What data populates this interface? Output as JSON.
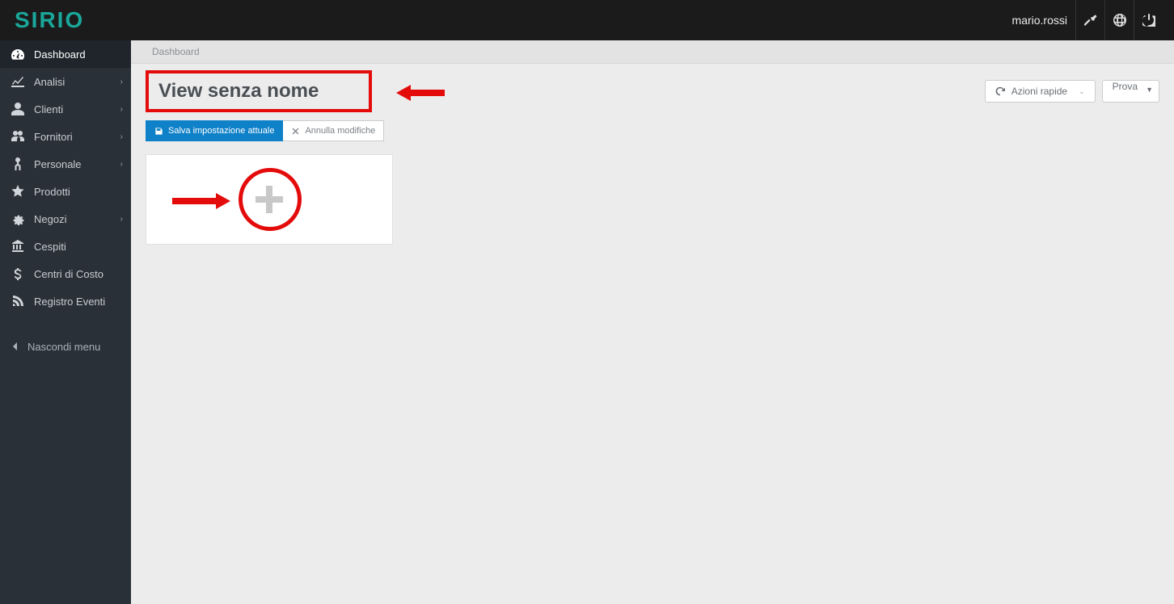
{
  "brand": "SIRIO",
  "user": {
    "name": "mario.rossi"
  },
  "sidebar": {
    "items": [
      {
        "label": "Dashboard",
        "icon": "dashboard",
        "active": true,
        "expandable": false
      },
      {
        "label": "Analisi",
        "icon": "chart",
        "active": false,
        "expandable": true
      },
      {
        "label": "Clienti",
        "icon": "user",
        "active": false,
        "expandable": true
      },
      {
        "label": "Fornitori",
        "icon": "users",
        "active": false,
        "expandable": true
      },
      {
        "label": "Personale",
        "icon": "person",
        "active": false,
        "expandable": true
      },
      {
        "label": "Prodotti",
        "icon": "star",
        "active": false,
        "expandable": false
      },
      {
        "label": "Negozi",
        "icon": "gear",
        "active": false,
        "expandable": true
      },
      {
        "label": "Cespiti",
        "icon": "columns",
        "active": false,
        "expandable": false
      },
      {
        "label": "Centri di Costo",
        "icon": "dollar",
        "active": false,
        "expandable": false
      },
      {
        "label": "Registro Eventi",
        "icon": "rss",
        "active": false,
        "expandable": false
      }
    ],
    "hide_label": "Nascondi menu"
  },
  "breadcrumb": "Dashboard",
  "page_title": "View senza nome",
  "header_buttons": {
    "quick_actions": "Azioni rapide",
    "selector_value": "Prova"
  },
  "toolbar": {
    "save": "Salva impostazione attuale",
    "cancel": "Annulla modifiche"
  }
}
